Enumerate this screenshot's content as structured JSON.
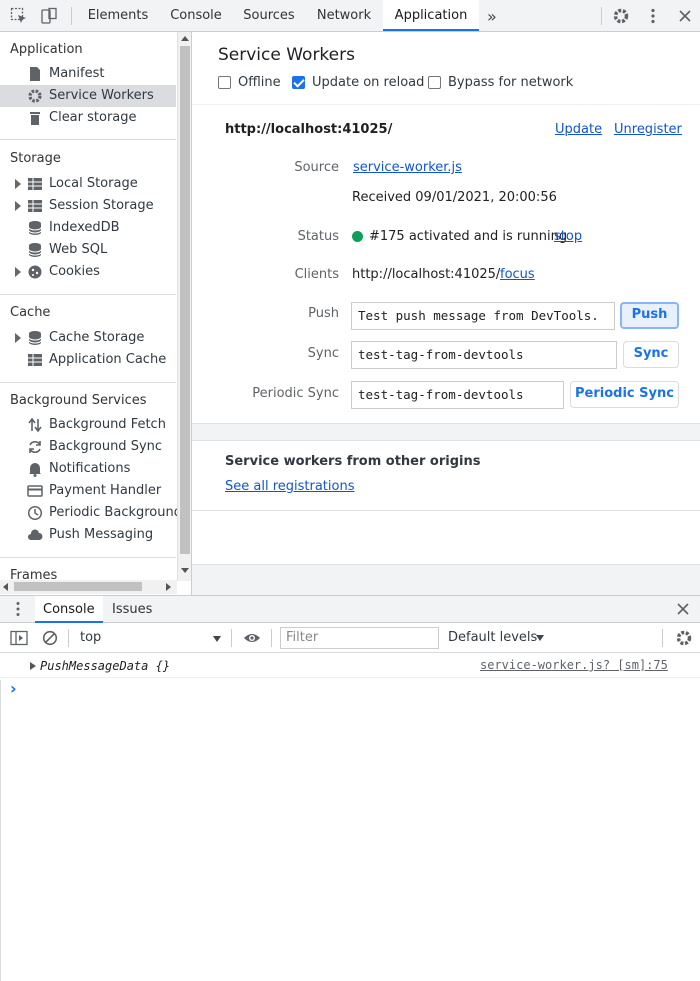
{
  "toolbar": {
    "tabs": [
      "Elements",
      "Console",
      "Sources",
      "Network",
      "Application"
    ],
    "active_tab": "Application",
    "more": "»"
  },
  "sidebar": {
    "sections": {
      "application": "Application",
      "storage": "Storage",
      "cache": "Cache",
      "background": "Background Services",
      "frames": "Frames"
    },
    "application_items": [
      "Manifest",
      "Service Workers",
      "Clear storage"
    ],
    "storage_items": [
      "Local Storage",
      "Session Storage",
      "IndexedDB",
      "Web SQL",
      "Cookies"
    ],
    "cache_items": [
      "Cache Storage",
      "Application Cache"
    ],
    "background_items": [
      "Background Fetch",
      "Background Sync",
      "Notifications",
      "Payment Handler",
      "Periodic Background Sync",
      "Push Messaging"
    ]
  },
  "main": {
    "title": "Service Workers",
    "options": {
      "offline": "Offline",
      "update_on_reload": "Update on reload",
      "bypass": "Bypass for network"
    },
    "options_state": {
      "offline": false,
      "update_on_reload": true,
      "bypass": false
    },
    "origin": "http://localhost:41025/",
    "update_link": "Update",
    "unregister_link": "Unregister",
    "source_label": "Source",
    "source_value": "service-worker.js",
    "received": "Received 09/01/2021, 20:00:56",
    "status_label": "Status",
    "status_value": "#175 activated and is running",
    "status_action": "stop",
    "status_color": "#0f9d58",
    "clients_label": "Clients",
    "clients_value": "http://localhost:41025/",
    "clients_action": "focus",
    "push_label": "Push",
    "push_value": "Test push message from DevTools.",
    "push_button": "Push",
    "sync_label": "Sync",
    "sync_value": "test-tag-from-devtools",
    "sync_button": "Sync",
    "periodic_label": "Periodic Sync",
    "periodic_value": "test-tag-from-devtools",
    "periodic_button": "Periodic Sync",
    "other_origins_title": "Service workers from other origins",
    "see_all": "See all registrations"
  },
  "drawer": {
    "tabs": [
      "Console",
      "Issues"
    ],
    "context": "top",
    "filter_placeholder": "Filter",
    "levels": "Default levels",
    "messages": [
      {
        "text": "PushMessageData {}",
        "source": "service-worker.js? [sm]:75"
      }
    ],
    "prompt": "›"
  },
  "colors": {
    "accent": "#1a73e8",
    "link": "#1155cc"
  }
}
